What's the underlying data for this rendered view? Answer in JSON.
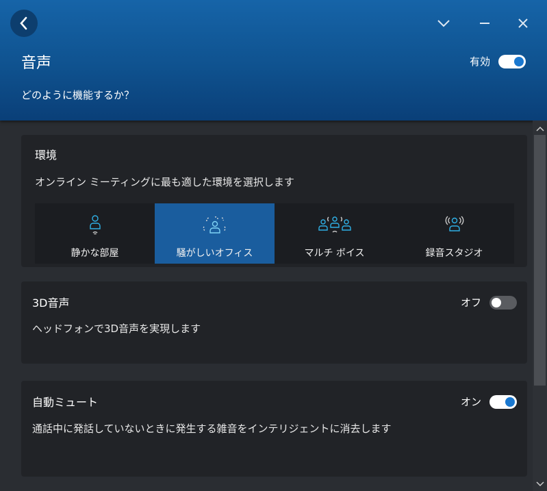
{
  "header": {
    "title": "音声",
    "subtitle": "どのように機能するか？",
    "enabled_label": "有効",
    "enabled": true
  },
  "environment": {
    "title": "環境",
    "description": "オンライン ミーティングに最も適した環境を選択します",
    "options": [
      {
        "label": "静かな部屋",
        "icon": "quiet-room-icon"
      },
      {
        "label": "騒がしいオフィス",
        "icon": "noisy-office-icon",
        "selected": true
      },
      {
        "label": "マルチ ボイス",
        "icon": "multi-voice-icon"
      },
      {
        "label": "録音スタジオ",
        "icon": "recording-studio-icon"
      }
    ]
  },
  "audio3d": {
    "title": "3D音声",
    "description": "ヘッドフォンで3D音声を実現します",
    "state_label": "オフ",
    "enabled": false
  },
  "automute": {
    "title": "自動ミュート",
    "description": "通話中に発話していないときに発生する雑音をインテリジェントに消去します",
    "state_label": "オン",
    "enabled": true
  },
  "colors": {
    "accent": "#1a78d0",
    "header": "#1664a8",
    "selected": "#1a5d9e"
  }
}
